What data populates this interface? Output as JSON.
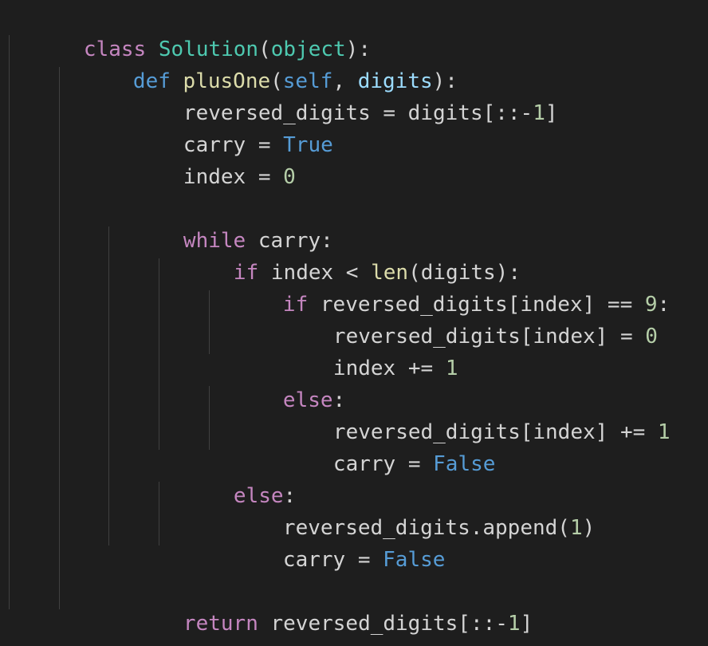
{
  "editor": {
    "code": {
      "l1": [
        "class",
        " ",
        "Solution",
        "(",
        "object",
        "):"
      ],
      "l2": [
        "def",
        " ",
        "plusOne",
        "(",
        "self",
        ", ",
        "digits",
        "):"
      ],
      "l3": [
        "reversed_digits = digits[::-",
        "1",
        "]"
      ],
      "l4": [
        "carry = ",
        "True"
      ],
      "l5": [
        "index = ",
        "0"
      ],
      "l6": [
        ""
      ],
      "l7": [
        "while",
        " carry:"
      ],
      "l8": [
        "if",
        " index < ",
        "len",
        "(digits):"
      ],
      "l9": [
        "if",
        " reversed_digits[index] == ",
        "9",
        ":"
      ],
      "l10": [
        "reversed_digits[index] = ",
        "0"
      ],
      "l11": [
        "index += ",
        "1"
      ],
      "l12": [
        "else",
        ":"
      ],
      "l13": [
        "reversed_digits[index] += ",
        "1"
      ],
      "l14": [
        "carry = ",
        "False"
      ],
      "l15": [
        "else",
        ":"
      ],
      "l16": [
        "reversed_digits.append(",
        "1",
        ")"
      ],
      "l17": [
        "carry = ",
        "False"
      ],
      "l18": [
        ""
      ],
      "l19": [
        "return",
        " reversed_digits[::-",
        "1",
        "]"
      ]
    }
  }
}
